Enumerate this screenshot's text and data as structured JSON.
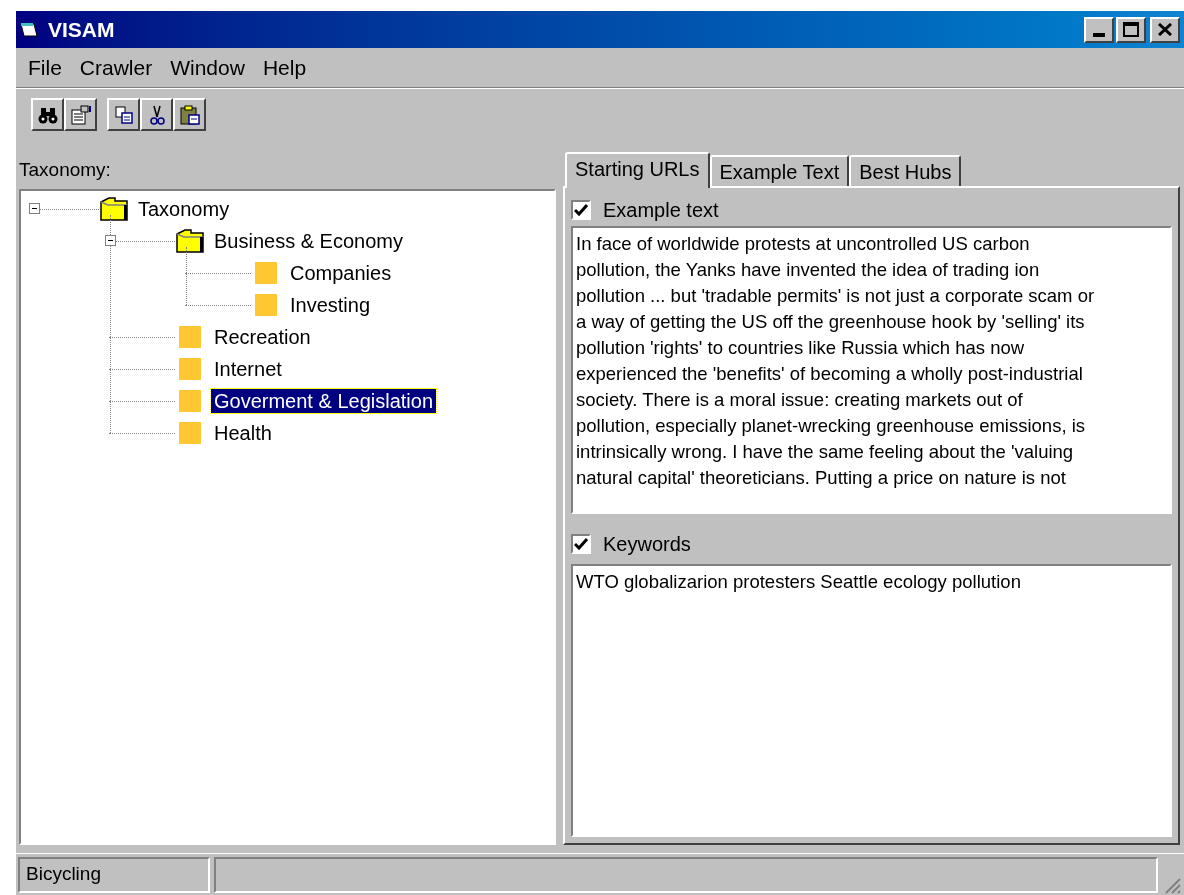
{
  "window": {
    "title": "VISAM"
  },
  "menu": [
    "File",
    "Crawler",
    "Window",
    "Help"
  ],
  "taxonomy_label": "Taxonomy:",
  "tree": [
    {
      "label": "Taxonomy",
      "kind": "folder",
      "expanded": true,
      "selected": false,
      "children": [
        {
          "label": "Business & Economy",
          "kind": "folder",
          "expanded": true,
          "selected": false,
          "children": [
            {
              "label": "Companies",
              "kind": "item",
              "selected": false
            },
            {
              "label": "Investing",
              "kind": "item",
              "selected": false
            }
          ]
        },
        {
          "label": "Recreation",
          "kind": "item",
          "selected": false
        },
        {
          "label": "Internet",
          "kind": "item",
          "selected": false
        },
        {
          "label": "Goverment & Legislation",
          "kind": "item",
          "selected": true
        },
        {
          "label": "Health",
          "kind": "item",
          "selected": false
        }
      ]
    }
  ],
  "tabs": [
    {
      "label": "Starting URLs",
      "selected": true
    },
    {
      "label": "Example Text",
      "selected": false
    },
    {
      "label": "Best Hubs",
      "selected": false
    }
  ],
  "example_text": {
    "label": "Example text",
    "checked": true,
    "lines": [
      "In face of worldwide protests at uncontrolled US carbon",
      "pollution, the Yanks have invented the idea of trading ion",
      "pollution ... but 'tradable permits' is not just a corporate scam or",
      "a way of getting the US off the greenhouse hook by 'selling' its",
      "pollution 'rights' to countries like Russia which has now",
      "experienced the 'benefits' of becoming a wholly post-industrial",
      "society. There is a moral issue: creating markets out of",
      "pollution, especially planet-wrecking greenhouse emissions, is",
      "intrinsically wrong. I have the same feeling about the 'valuing",
      "natural capital' theoreticians. Putting a price on nature is not"
    ]
  },
  "keywords": {
    "label": "Keywords",
    "checked": true,
    "value": "WTO globalizarion protesters Seattle ecology pollution"
  },
  "status_bar": [
    "Bicycling"
  ]
}
